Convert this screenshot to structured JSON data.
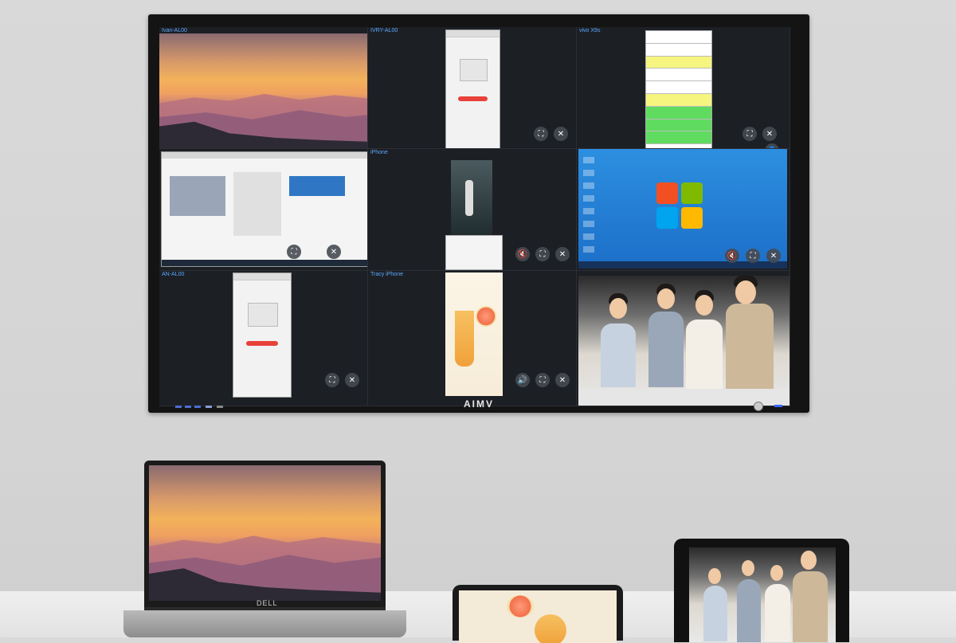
{
  "display": {
    "brand": "AIMV",
    "tiles": [
      {
        "label": "Ivan-AL00"
      },
      {
        "label": "IVRY-AL00"
      },
      {
        "label": "vivo X9s"
      },
      {
        "label": ""
      },
      {
        "label": "iPhone"
      },
      {
        "label": ""
      },
      {
        "label": "AN-AL00"
      },
      {
        "label": "Tracy iPhone"
      },
      {
        "label": ""
      }
    ],
    "controls": {
      "fullscreen": "⛶",
      "close": "✕",
      "mute": "🔇",
      "volume": "🔊",
      "user": "👤"
    }
  },
  "laptop": {
    "brand": "DELL"
  },
  "colors": {
    "accent": "#5aa8ff",
    "bezel": "#141414",
    "stop_button": "#e8413a"
  }
}
